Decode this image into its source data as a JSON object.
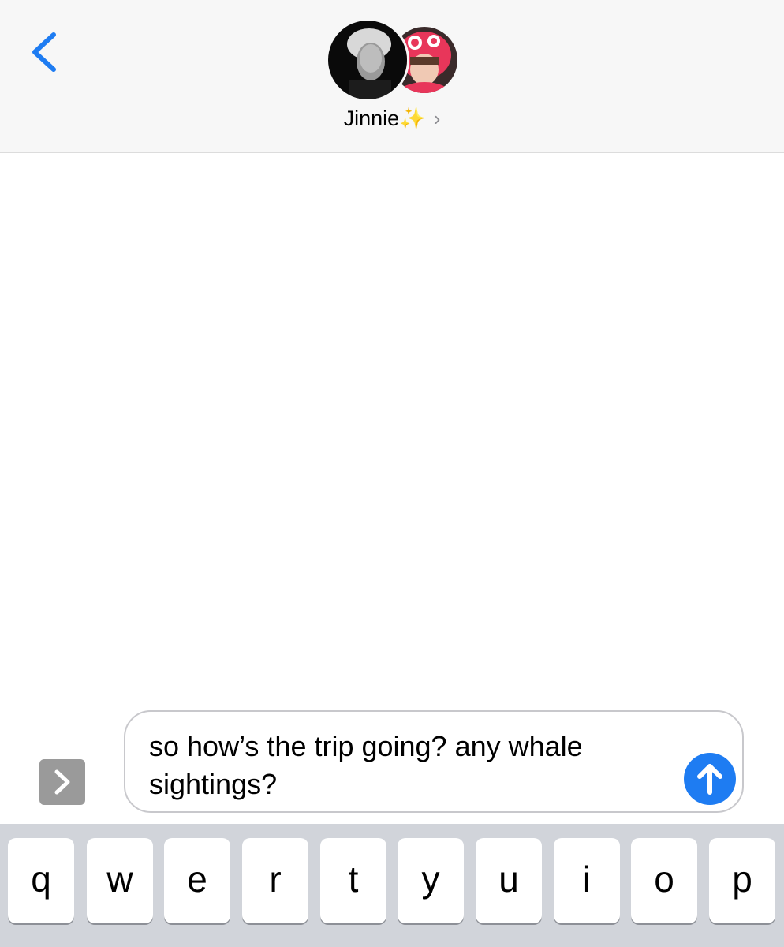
{
  "header": {
    "contact_name": "Jinnie",
    "sparkle": "✨",
    "chevron": "›",
    "back_icon": "chevron-left-icon"
  },
  "composer": {
    "text": "so how’s the trip going? any whale sightings?",
    "send_icon": "arrow-up-icon",
    "expand_icon": "chevron-right-icon"
  },
  "keyboard": {
    "row1": [
      "q",
      "w",
      "e",
      "r",
      "t",
      "y",
      "u",
      "i",
      "o",
      "p"
    ]
  },
  "colors": {
    "accent": "#1e7cf2",
    "header_bg": "#f7f7f7",
    "keyboard_bg": "#d1d4da"
  }
}
